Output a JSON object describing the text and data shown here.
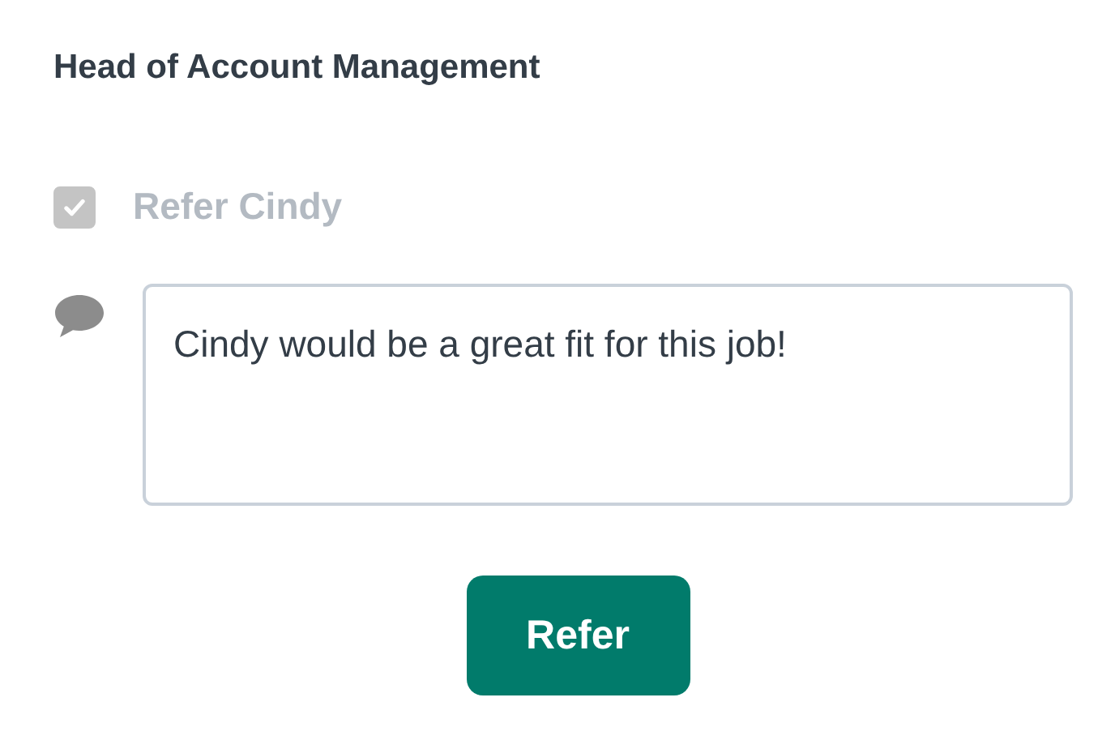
{
  "title": "Head of Account Management",
  "referral": {
    "label": "Refer Cindy",
    "checked": true,
    "disabled": true
  },
  "comment": {
    "value": "Cindy would be a great fit for this job!"
  },
  "button": {
    "label": "Refer"
  }
}
